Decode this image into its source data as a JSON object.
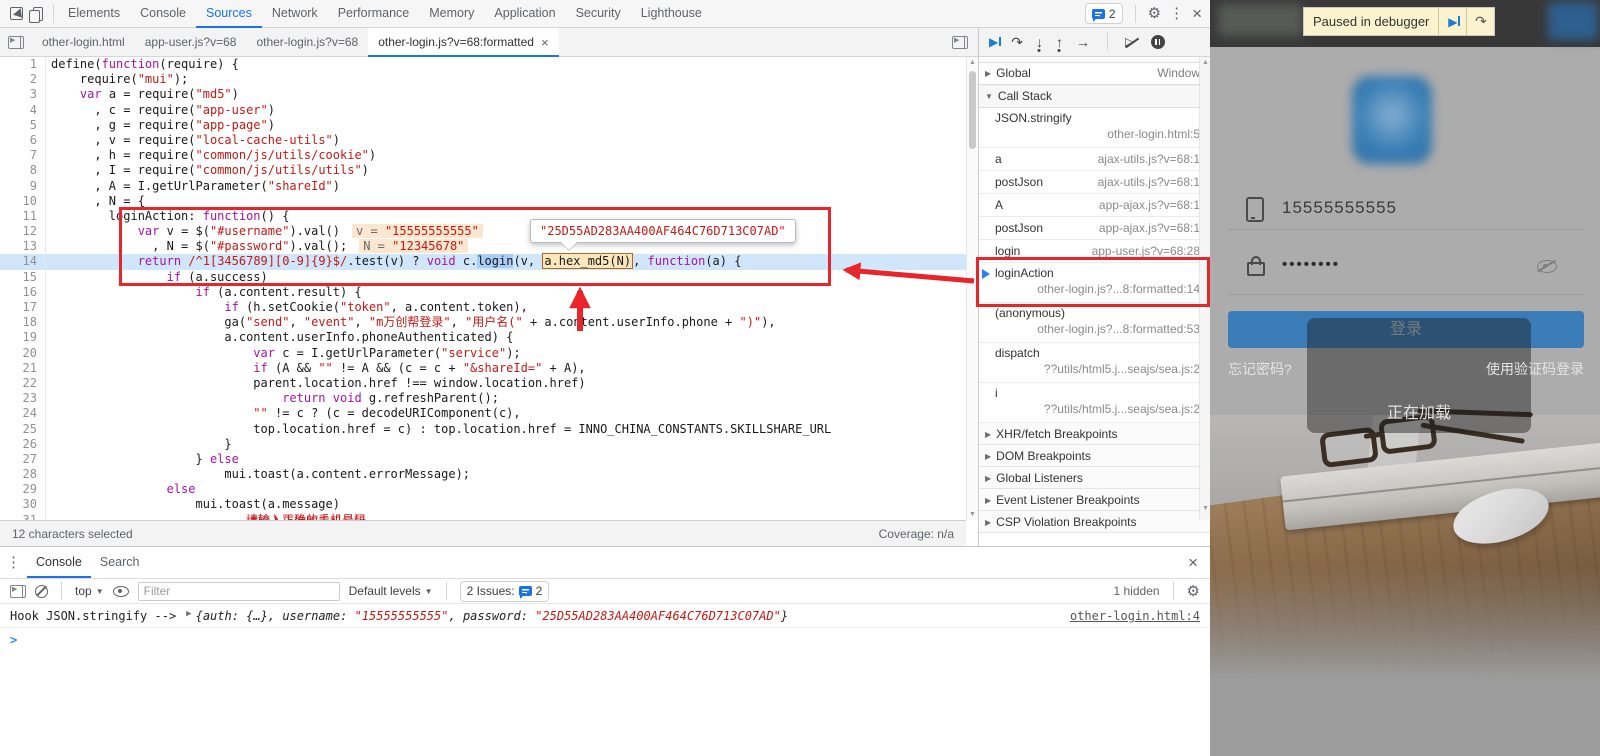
{
  "colors": {
    "accent": "#1a73e8",
    "annotation_red": "#e8252b",
    "exec_line": "#cfe6fb",
    "keyword": "#a712a6",
    "string": "#c41a16",
    "button_blue": "#3a7cb8"
  },
  "icons": {
    "settings": "⚙",
    "more_vertical": "⋮",
    "close": "×",
    "resume": "▶",
    "step_over": "↷",
    "step_into": "↓",
    "step_out": "↑",
    "step": "→",
    "collapsed": "▶",
    "expanded": "▼",
    "caret_down": "▼",
    "scroll_up": "▲",
    "scroll_down": "▼",
    "prompt": ">"
  },
  "devtools": {
    "main_tabs": [
      "Elements",
      "Console",
      "Sources",
      "Network",
      "Performance",
      "Memory",
      "Application",
      "Security",
      "Lighthouse"
    ],
    "active_main_tab": "Sources",
    "issues_count": "2",
    "file_tabs": [
      "other-login.html",
      "app-user.js?v=68",
      "other-login.js?v=68",
      "other-login.js?v=68:formatted"
    ],
    "active_file_tab": "other-login.js?v=68:formatted",
    "status_left": "12 characters selected",
    "status_right": "Coverage: n/a"
  },
  "editor": {
    "tooltip": "\"25D55AD283AA400AF464C76D713C07AD\"",
    "clipped_line_text": "请输入正确的手机号码",
    "lines": [
      {
        "n": 1,
        "t": [
          [
            "d",
            "define("
          ],
          [
            "k",
            "function"
          ],
          [
            "d",
            "(require) {"
          ]
        ]
      },
      {
        "n": 2,
        "t": [
          [
            "d",
            "    require("
          ],
          [
            "s",
            "\"mui\""
          ],
          [
            "d",
            ");"
          ]
        ]
      },
      {
        "n": 3,
        "t": [
          [
            "d",
            "    "
          ],
          [
            "k",
            "var"
          ],
          [
            "d",
            " a = require("
          ],
          [
            "s",
            "\"md5\""
          ],
          [
            "d",
            ")"
          ]
        ]
      },
      {
        "n": 4,
        "t": [
          [
            "d",
            "      , c = require("
          ],
          [
            "s",
            "\"app-user\""
          ],
          [
            "d",
            ")"
          ]
        ]
      },
      {
        "n": 5,
        "t": [
          [
            "d",
            "      , g = require("
          ],
          [
            "s",
            "\"app-page\""
          ],
          [
            "d",
            ")"
          ]
        ]
      },
      {
        "n": 6,
        "t": [
          [
            "d",
            "      , v = require("
          ],
          [
            "s",
            "\"local-cache-utils\""
          ],
          [
            "d",
            ")"
          ]
        ]
      },
      {
        "n": 7,
        "t": [
          [
            "d",
            "      , h = require("
          ],
          [
            "s",
            "\"common/js/utils/cookie\""
          ],
          [
            "d",
            ")"
          ]
        ]
      },
      {
        "n": 8,
        "t": [
          [
            "d",
            "      , I = require("
          ],
          [
            "s",
            "\"common/js/utils/utils\""
          ],
          [
            "d",
            ")"
          ]
        ]
      },
      {
        "n": 9,
        "t": [
          [
            "d",
            "      , A = I.getUrlParameter("
          ],
          [
            "s",
            "\"shareId\""
          ],
          [
            "d",
            ")"
          ]
        ]
      },
      {
        "n": 10,
        "t": [
          [
            "d",
            "      , N = {"
          ]
        ]
      },
      {
        "n": 11,
        "t": [
          [
            "d",
            "        loginAction: "
          ],
          [
            "k",
            "function"
          ],
          [
            "d",
            "() {"
          ]
        ]
      },
      {
        "n": 12,
        "t": [
          [
            "d",
            "            "
          ],
          [
            "k",
            "var"
          ],
          [
            "d",
            " v = $("
          ],
          [
            "s",
            "\"#username\""
          ],
          [
            "d",
            ").val()"
          ]
        ],
        "badge": [
          "v = ",
          "\"15555555555\""
        ]
      },
      {
        "n": 13,
        "t": [
          [
            "d",
            "              , N = $("
          ],
          [
            "s",
            "\"#password\""
          ],
          [
            "d",
            ").val();"
          ]
        ],
        "badge": [
          "N = ",
          "\"12345678\""
        ]
      },
      {
        "n": 14,
        "exec": true,
        "t": [
          [
            "d",
            "            "
          ],
          [
            "k",
            "return"
          ],
          [
            "d",
            " "
          ],
          [
            "s",
            "/^1[3456789][0-9]{9}$/"
          ],
          [
            "d",
            ".test(v) ? "
          ],
          [
            "k",
            "void"
          ],
          [
            "d",
            " c."
          ],
          [
            "sel",
            "login"
          ],
          [
            "d",
            "(v, "
          ],
          [
            "box",
            "a.hex_md5(N)"
          ],
          [
            "d",
            ", "
          ],
          [
            "k",
            "function"
          ],
          [
            "d",
            "(a) {"
          ]
        ]
      },
      {
        "n": 15,
        "t": [
          [
            "d",
            "                "
          ],
          [
            "k",
            "if"
          ],
          [
            "d",
            " (a.success)"
          ]
        ]
      },
      {
        "n": 16,
        "t": [
          [
            "d",
            "                    "
          ],
          [
            "k",
            "if"
          ],
          [
            "d",
            " (a.content.result) {"
          ]
        ]
      },
      {
        "n": 17,
        "t": [
          [
            "d",
            "                        "
          ],
          [
            "k",
            "if"
          ],
          [
            "d",
            " (h.setCookie("
          ],
          [
            "s",
            "\"token\""
          ],
          [
            "d",
            ", a.content.token),"
          ]
        ]
      },
      {
        "n": 18,
        "t": [
          [
            "d",
            "                        ga("
          ],
          [
            "s",
            "\"send\""
          ],
          [
            "d",
            ", "
          ],
          [
            "s",
            "\"event\""
          ],
          [
            "d",
            ", "
          ],
          [
            "s",
            "\"m万创帮登录\""
          ],
          [
            "d",
            ", "
          ],
          [
            "s",
            "\"用户名(\""
          ],
          [
            "d",
            " + a.content.userInfo.phone + "
          ],
          [
            "s",
            "\")\""
          ],
          [
            "d",
            "),"
          ]
        ]
      },
      {
        "n": 19,
        "t": [
          [
            "d",
            "                        a.content.userInfo.phoneAuthenticated) {"
          ]
        ]
      },
      {
        "n": 20,
        "t": [
          [
            "d",
            "                            "
          ],
          [
            "k",
            "var"
          ],
          [
            "d",
            " c = I.getUrlParameter("
          ],
          [
            "s",
            "\"service\""
          ],
          [
            "d",
            ");"
          ]
        ]
      },
      {
        "n": 21,
        "t": [
          [
            "d",
            "                            "
          ],
          [
            "k",
            "if"
          ],
          [
            "d",
            " (A && "
          ],
          [
            "s",
            "\"\""
          ],
          [
            "d",
            " != A && (c = c + "
          ],
          [
            "s",
            "\"&shareId=\""
          ],
          [
            "d",
            " + A),"
          ]
        ]
      },
      {
        "n": 22,
        "t": [
          [
            "d",
            "                            parent.location.href !== window.location.href)"
          ]
        ]
      },
      {
        "n": 23,
        "t": [
          [
            "d",
            "                                "
          ],
          [
            "k",
            "return"
          ],
          [
            "d",
            " "
          ],
          [
            "k",
            "void"
          ],
          [
            "d",
            " g.refreshParent();"
          ]
        ]
      },
      {
        "n": 24,
        "t": [
          [
            "d",
            "                            "
          ],
          [
            "s",
            "\"\""
          ],
          [
            "d",
            " != c ? (c = decodeURIComponent(c),"
          ]
        ]
      },
      {
        "n": 25,
        "t": [
          [
            "d",
            "                            top.location.href = c) : top.location.href = INNO_CHINA_CONSTANTS.SKILLSHARE_URL"
          ]
        ]
      },
      {
        "n": 26,
        "t": [
          [
            "d",
            "                        }"
          ]
        ]
      },
      {
        "n": 27,
        "t": [
          [
            "d",
            "                    } "
          ],
          [
            "k",
            "else"
          ]
        ]
      },
      {
        "n": 28,
        "t": [
          [
            "d",
            "                        mui.toast(a.content.errorMessage);"
          ]
        ]
      },
      {
        "n": 29,
        "t": [
          [
            "d",
            "                "
          ],
          [
            "k",
            "else"
          ]
        ]
      },
      {
        "n": 30,
        "t": [
          [
            "d",
            "                    mui.toast(a.message)"
          ]
        ]
      },
      {
        "n": 31,
        "t": [
          [
            "d",
            "                           "
          ],
          [
            "s",
            "请输入正确的手机号码"
          ]
        ]
      }
    ]
  },
  "sidebar": {
    "scope_row": {
      "label": "Global",
      "value": "Window"
    },
    "call_stack_title": "Call Stack",
    "frames": [
      {
        "name": "JSON.stringify",
        "loc": "other-login.html:5",
        "two": true
      },
      {
        "name": "a",
        "loc": "ajax-utils.js?v=68:1"
      },
      {
        "name": "postJson",
        "loc": "ajax-utils.js?v=68:1"
      },
      {
        "name": "A",
        "loc": "app-ajax.js?v=68:1"
      },
      {
        "name": "postJson",
        "loc": "app-ajax.js?v=68:1"
      },
      {
        "name": "login",
        "loc": "app-user.js?v=68:28"
      },
      {
        "name": "loginAction",
        "loc": "other-login.js?...8:formatted:14",
        "two": true,
        "current": true
      },
      {
        "name": "(anonymous)",
        "loc": "other-login.js?...8:formatted:53",
        "two": true
      },
      {
        "name": "dispatch",
        "loc": "??utils/html5.j...seajs/sea.js:2",
        "two": true
      },
      {
        "name": "i",
        "loc": "??utils/html5.j...seajs/sea.js:2",
        "two": true
      }
    ],
    "sections": [
      "XHR/fetch Breakpoints",
      "DOM Breakpoints",
      "Global Listeners",
      "Event Listener Breakpoints",
      "CSP Violation Breakpoints"
    ]
  },
  "console": {
    "tabs": [
      "Console",
      "Search"
    ],
    "active_tab": "Console",
    "context": "top",
    "filter_placeholder": "Filter",
    "levels_label": "Default levels",
    "issues_label": "2 Issues:",
    "issues_count": "2",
    "hidden_label": "1 hidden",
    "message_prefix": "Hook JSON.stringify --> ",
    "preview": [
      [
        "p",
        "{"
      ],
      [
        "i",
        "auth"
      ],
      [
        "p",
        ": {…}, "
      ],
      [
        "i",
        "username"
      ],
      [
        "p",
        ": "
      ],
      [
        "st",
        "\"15555555555\""
      ],
      [
        "p",
        ", "
      ],
      [
        "i",
        "password"
      ],
      [
        "p",
        ": "
      ],
      [
        "st",
        "\"25D55AD283AA400AF464C76D713C07AD\""
      ],
      [
        "p",
        "}"
      ]
    ],
    "source_link": "other-login.html:4"
  },
  "webpage": {
    "paused_banner": "Paused in debugger",
    "phone": "15555555555",
    "password_dots": "••••••••",
    "login_button": "登录",
    "forgot_link": "忘记密码?",
    "sms_login_link": "使用验证码登录",
    "loading_text": "正在加载"
  }
}
